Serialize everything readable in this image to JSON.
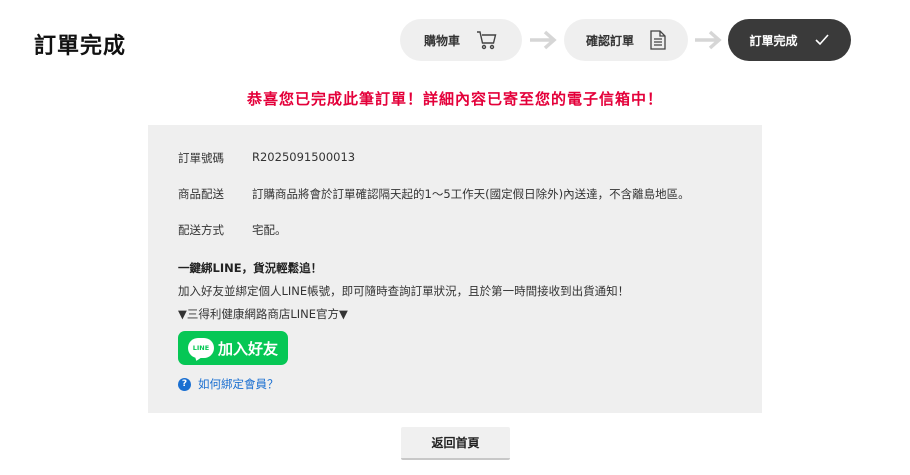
{
  "page_title": "訂單完成",
  "steps": [
    {
      "label": "購物車",
      "icon": "cart-icon"
    },
    {
      "label": "確認訂單",
      "icon": "document-icon"
    },
    {
      "label": "訂單完成",
      "icon": "check-icon"
    }
  ],
  "success_message": "恭喜您已完成此筆訂單！詳細內容已寄至您的電子信箱中！",
  "order": {
    "number_label": "訂單號碼",
    "number_value": "R2025091500013",
    "delivery_label": "商品配送",
    "delivery_value": "訂購商品將會於訂單確認隔天起的1～5工作天(國定假日除外)內送達，不含離島地區。",
    "method_label": "配送方式",
    "method_value": "宅配。"
  },
  "line": {
    "title": "一鍵綁LINE，貨況輕鬆追！",
    "description": "加入好友並綁定個人LINE帳號，即可隨時查詢訂單狀況，且於第一時間接收到出貨通知！",
    "official": "▼三得利健康網路商店LINE官方▼",
    "logo_text": "LINE",
    "add_friend_label": "加入好友",
    "help_label": "如何綁定會員？"
  },
  "home_button": "返回首頁",
  "colors": {
    "accent": "#e4003a",
    "line_green": "#06c755",
    "link_blue": "#1a6fd1",
    "active_step": "#3a3a3a"
  }
}
